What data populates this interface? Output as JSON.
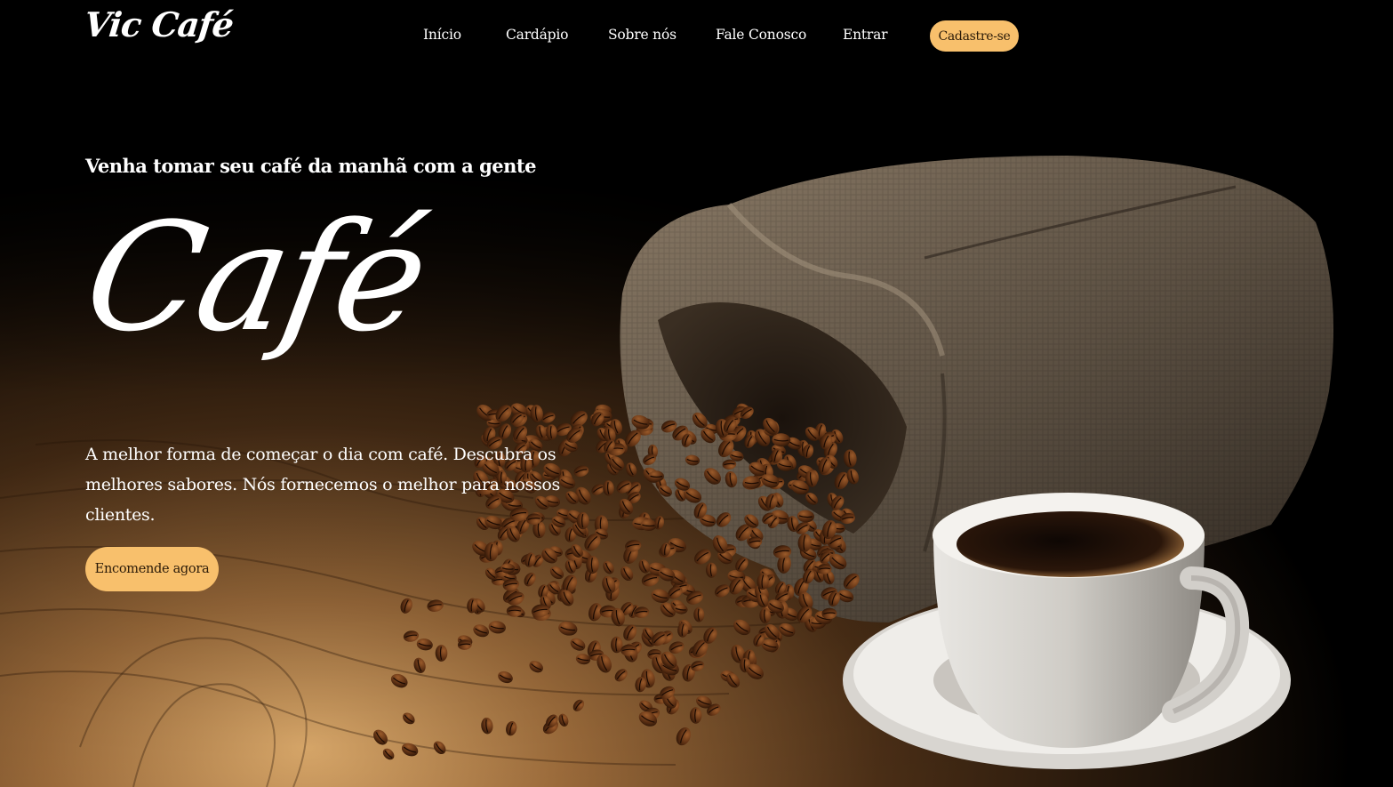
{
  "header": {
    "logo": "Vic Café",
    "nav": [
      {
        "label": "Início"
      },
      {
        "label": "Cardápio"
      },
      {
        "label": "Sobre nós"
      },
      {
        "label": "Fale Conosco"
      },
      {
        "label": "Entrar"
      }
    ],
    "cta_label": "Cadastre-se"
  },
  "hero": {
    "tagline": "Venha tomar seu café da manhã com a gente",
    "title": "Café",
    "description": "A melhor forma de começar o dia com café. Descubra os melhores sabores. Nós fornecemos o melhor para nossos clientes.",
    "button_label": "Encomende agora",
    "image": "coffee-bag-beans-cup"
  },
  "colors": {
    "accent": "#f8c06c",
    "background": "#000000",
    "text": "#ffffff",
    "button_text": "#2a1a08"
  }
}
